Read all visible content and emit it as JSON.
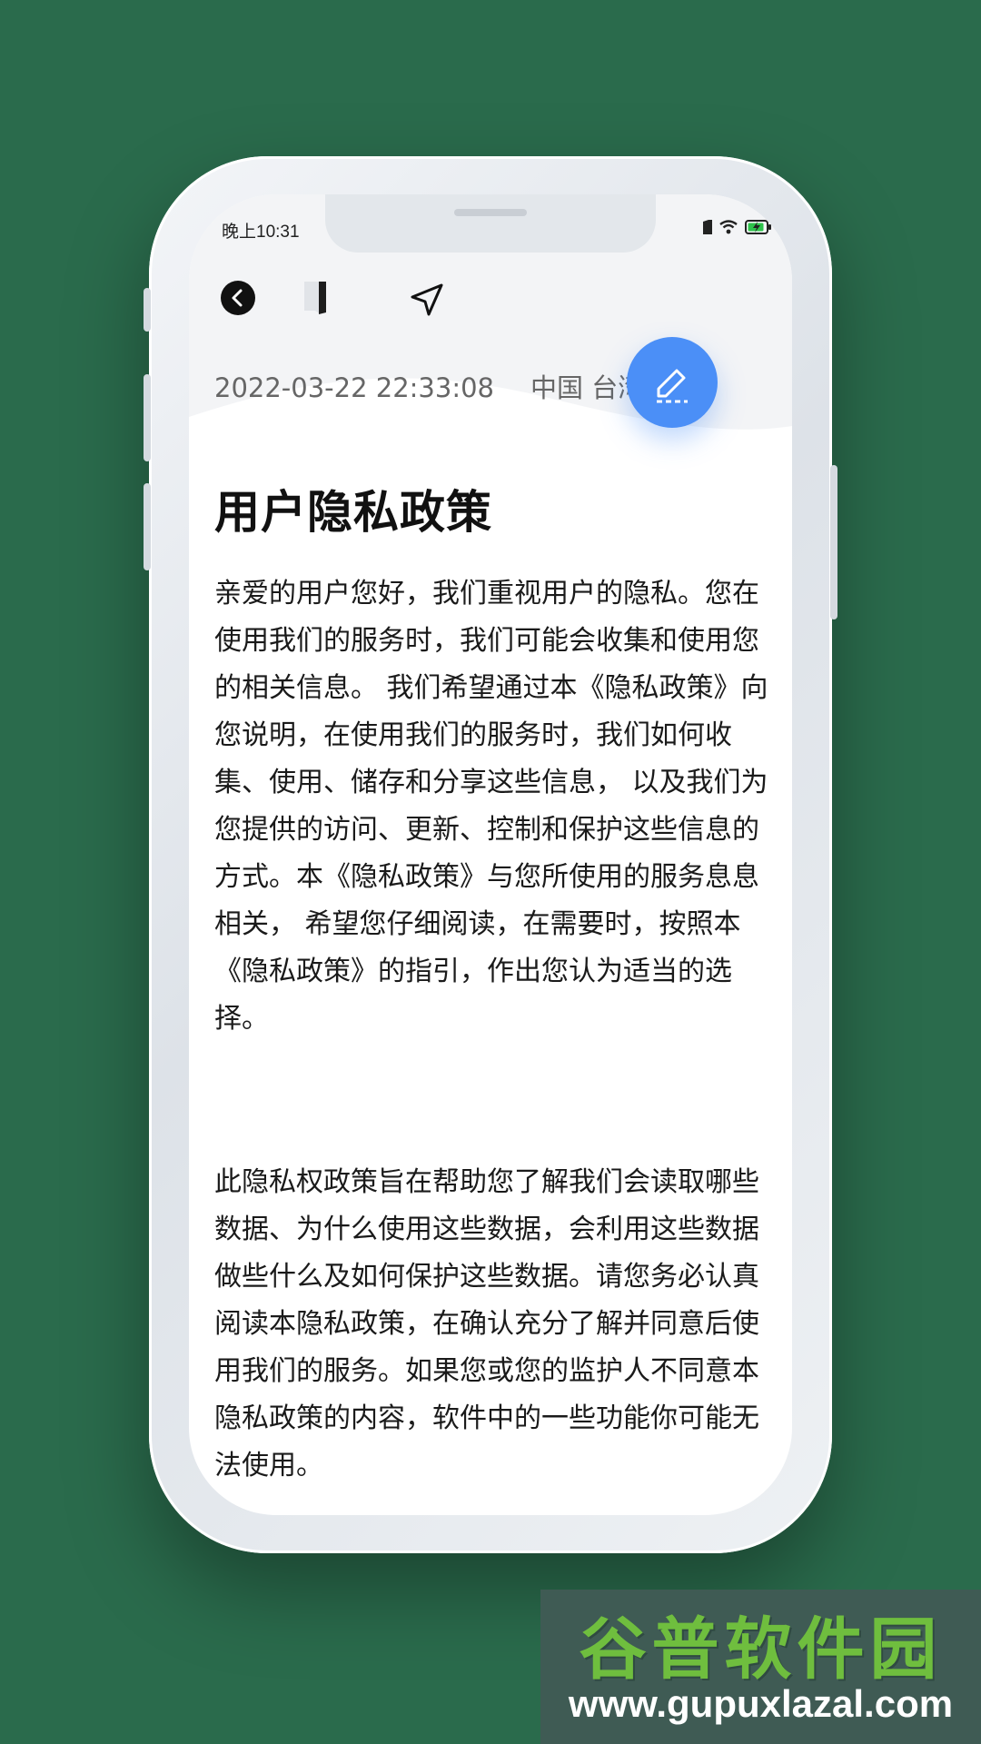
{
  "status_bar": {
    "time": "晚上10:31",
    "icons": [
      "sim-icon",
      "wifi-icon",
      "battery-charging-icon"
    ]
  },
  "toolbar": {
    "icons": [
      "back-icon",
      "bookmark-icon",
      "location-arrow-icon"
    ]
  },
  "meta": {
    "datetime": "2022-03-22 22:33:08",
    "location": "中国 台湾"
  },
  "fab": {
    "icon": "edit-icon",
    "color": "#4b8ff7"
  },
  "article": {
    "title": "用户隐私政策",
    "paragraphs": [
      "亲爱的用户您好，我们重视用户的隐私。您在使用我们的服务时，我们可能会收集和使用您的相关信息。 我们希望通过本《隐私政策》向您说明，在使用我们的服务时，我们如何收集、使用、储存和分享这些信息， 以及我们为您提供的访问、更新、控制和保护这些信息的方式。本《隐私政策》与您所使用的服务息息相关， 希望您仔细阅读，在需要时，按照本《隐私政策》的指引，作出您认为适当的选择。",
      "此隐私权政策旨在帮助您了解我们会读取哪些数据、为什么使用这些数据，会利用这些数据做些什么及如何保护这些数据。请您务必认真阅读本隐私政策，在确认充分了解并同意后使用我们的服务。如果您或您的监护人不同意本隐私政策的内容，软件中的一些功能你可能无法使用。"
    ]
  },
  "watermark": {
    "name": "谷普软件园",
    "url": "www.gupuxlazal.com"
  },
  "colors": {
    "background": "#2a6b4c",
    "accent": "#4b8ff7"
  }
}
